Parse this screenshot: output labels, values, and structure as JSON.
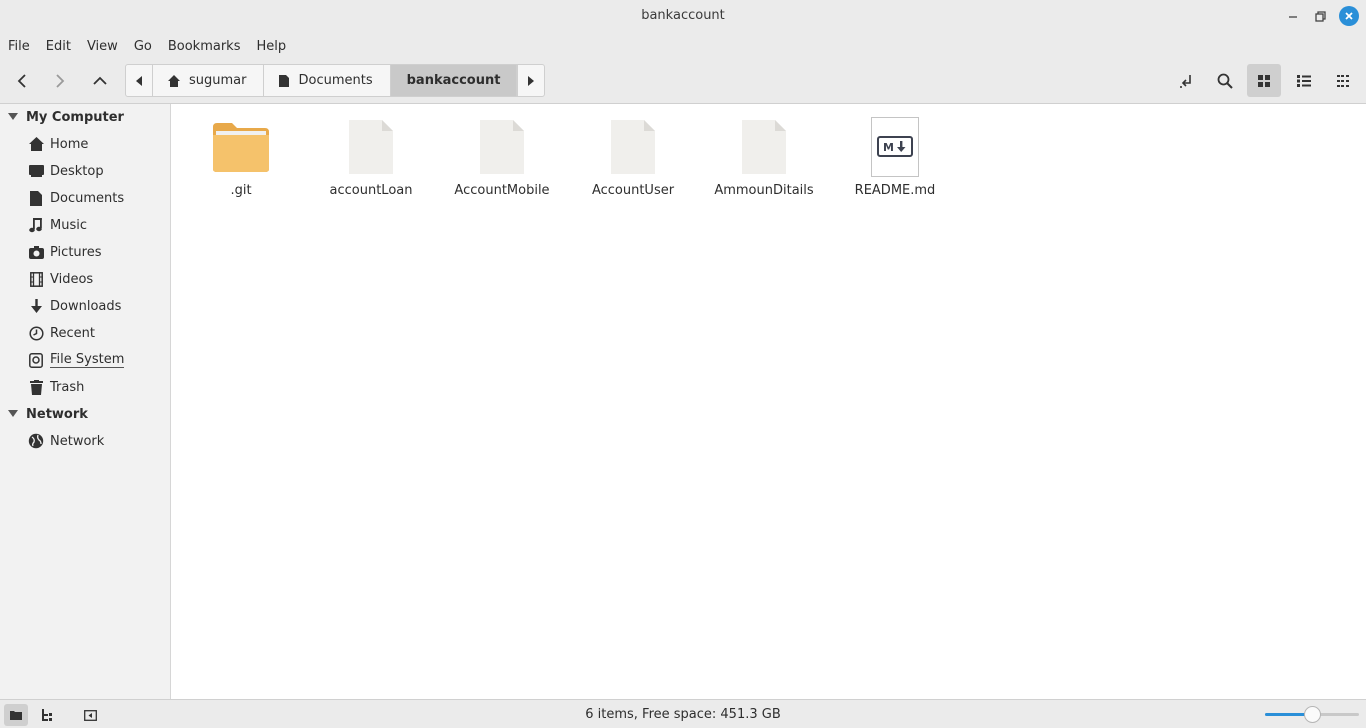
{
  "window": {
    "title": "bankaccount",
    "minimize_label": "–",
    "maximize_label": "❐",
    "close_label": "✕"
  },
  "menubar": [
    "File",
    "Edit",
    "View",
    "Go",
    "Bookmarks",
    "Help"
  ],
  "toolbar": {
    "back_icon": "back-arrow-icon",
    "forward_icon": "forward-arrow-icon",
    "up_icon": "up-arrow-icon",
    "breadcrumbs": [
      {
        "label": "sugumar",
        "icon": "home-icon"
      },
      {
        "label": "Documents",
        "icon": "document-icon"
      },
      {
        "label": "bankaccount",
        "icon": null,
        "active": true
      }
    ],
    "view_mode": "icons"
  },
  "sidebar": {
    "sections": [
      {
        "label": "My Computer",
        "items": [
          {
            "label": "Home",
            "icon": "home-icon"
          },
          {
            "label": "Desktop",
            "icon": "desktop-icon"
          },
          {
            "label": "Documents",
            "icon": "document-icon"
          },
          {
            "label": "Music",
            "icon": "music-icon"
          },
          {
            "label": "Pictures",
            "icon": "camera-icon"
          },
          {
            "label": "Videos",
            "icon": "film-icon"
          },
          {
            "label": "Downloads",
            "icon": "download-icon"
          },
          {
            "label": "Recent",
            "icon": "clock-icon"
          },
          {
            "label": "File System",
            "icon": "drive-icon"
          },
          {
            "label": "Trash",
            "icon": "trash-icon"
          }
        ]
      },
      {
        "label": "Network",
        "items": [
          {
            "label": "Network",
            "icon": "globe-icon"
          }
        ]
      }
    ]
  },
  "files": [
    {
      "name": ".git",
      "type": "folder"
    },
    {
      "name": "accountLoan",
      "type": "file"
    },
    {
      "name": "AccountMobile",
      "type": "file"
    },
    {
      "name": "AccountUser",
      "type": "file"
    },
    {
      "name": "AmmounDitails",
      "type": "file"
    },
    {
      "name": "README.md",
      "type": "markdown",
      "badge": "M↓"
    }
  ],
  "statusbar": {
    "text": "6 items, Free space: 451.3 GB",
    "zoom_level": 0.5
  },
  "colors": {
    "accent": "#2a8fd8",
    "folder": "#f5c26b",
    "chrome": "#ebebeb"
  }
}
